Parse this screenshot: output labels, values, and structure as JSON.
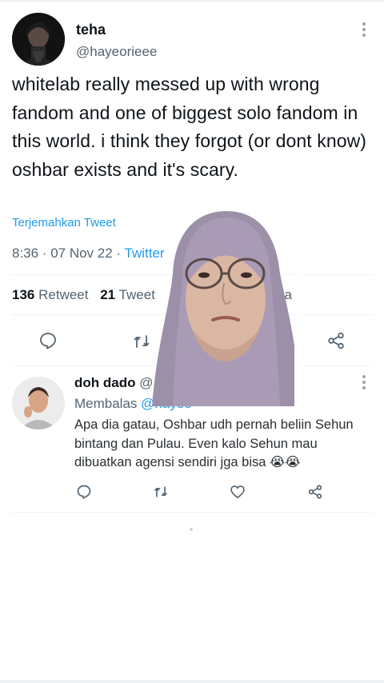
{
  "tweet": {
    "display_name": "teha",
    "handle": "@hayeorieee",
    "text": "whitelab really messed up with wrong fandom and one of biggest solo fandom in this world. i think they forgot (or dont know) oshbar exists and it's scary.",
    "translate_label": "Terjemahkan Tweet",
    "time": "8:36 · 07 Nov 22 · ",
    "source": "Twitter",
    "stats": {
      "retweets_count": "136",
      "retweets_label": "Retweet",
      "quotes_count": "21",
      "quotes_label": "Tweet",
      "likes_label_fragment": "ka"
    }
  },
  "reply": {
    "display_name": "doh dado",
    "handle_fragment": "@",
    "replying_label": "Membalas",
    "replying_handle_fragment": "@hayeo",
    "text": "Apa dia gatau, Oshbar udh pernah beliin Sehun bintang dan Pulau. Even kalo Sehun mau dibuatkan agensi sendiri jga bisa",
    "emoji": "😭😭"
  },
  "overlay": {
    "description_icon": "person-in-hijab-photo"
  },
  "colors": {
    "accent": "#1d9bf0",
    "text": "#0f1419",
    "muted": "#536471",
    "icon": "#536471"
  }
}
